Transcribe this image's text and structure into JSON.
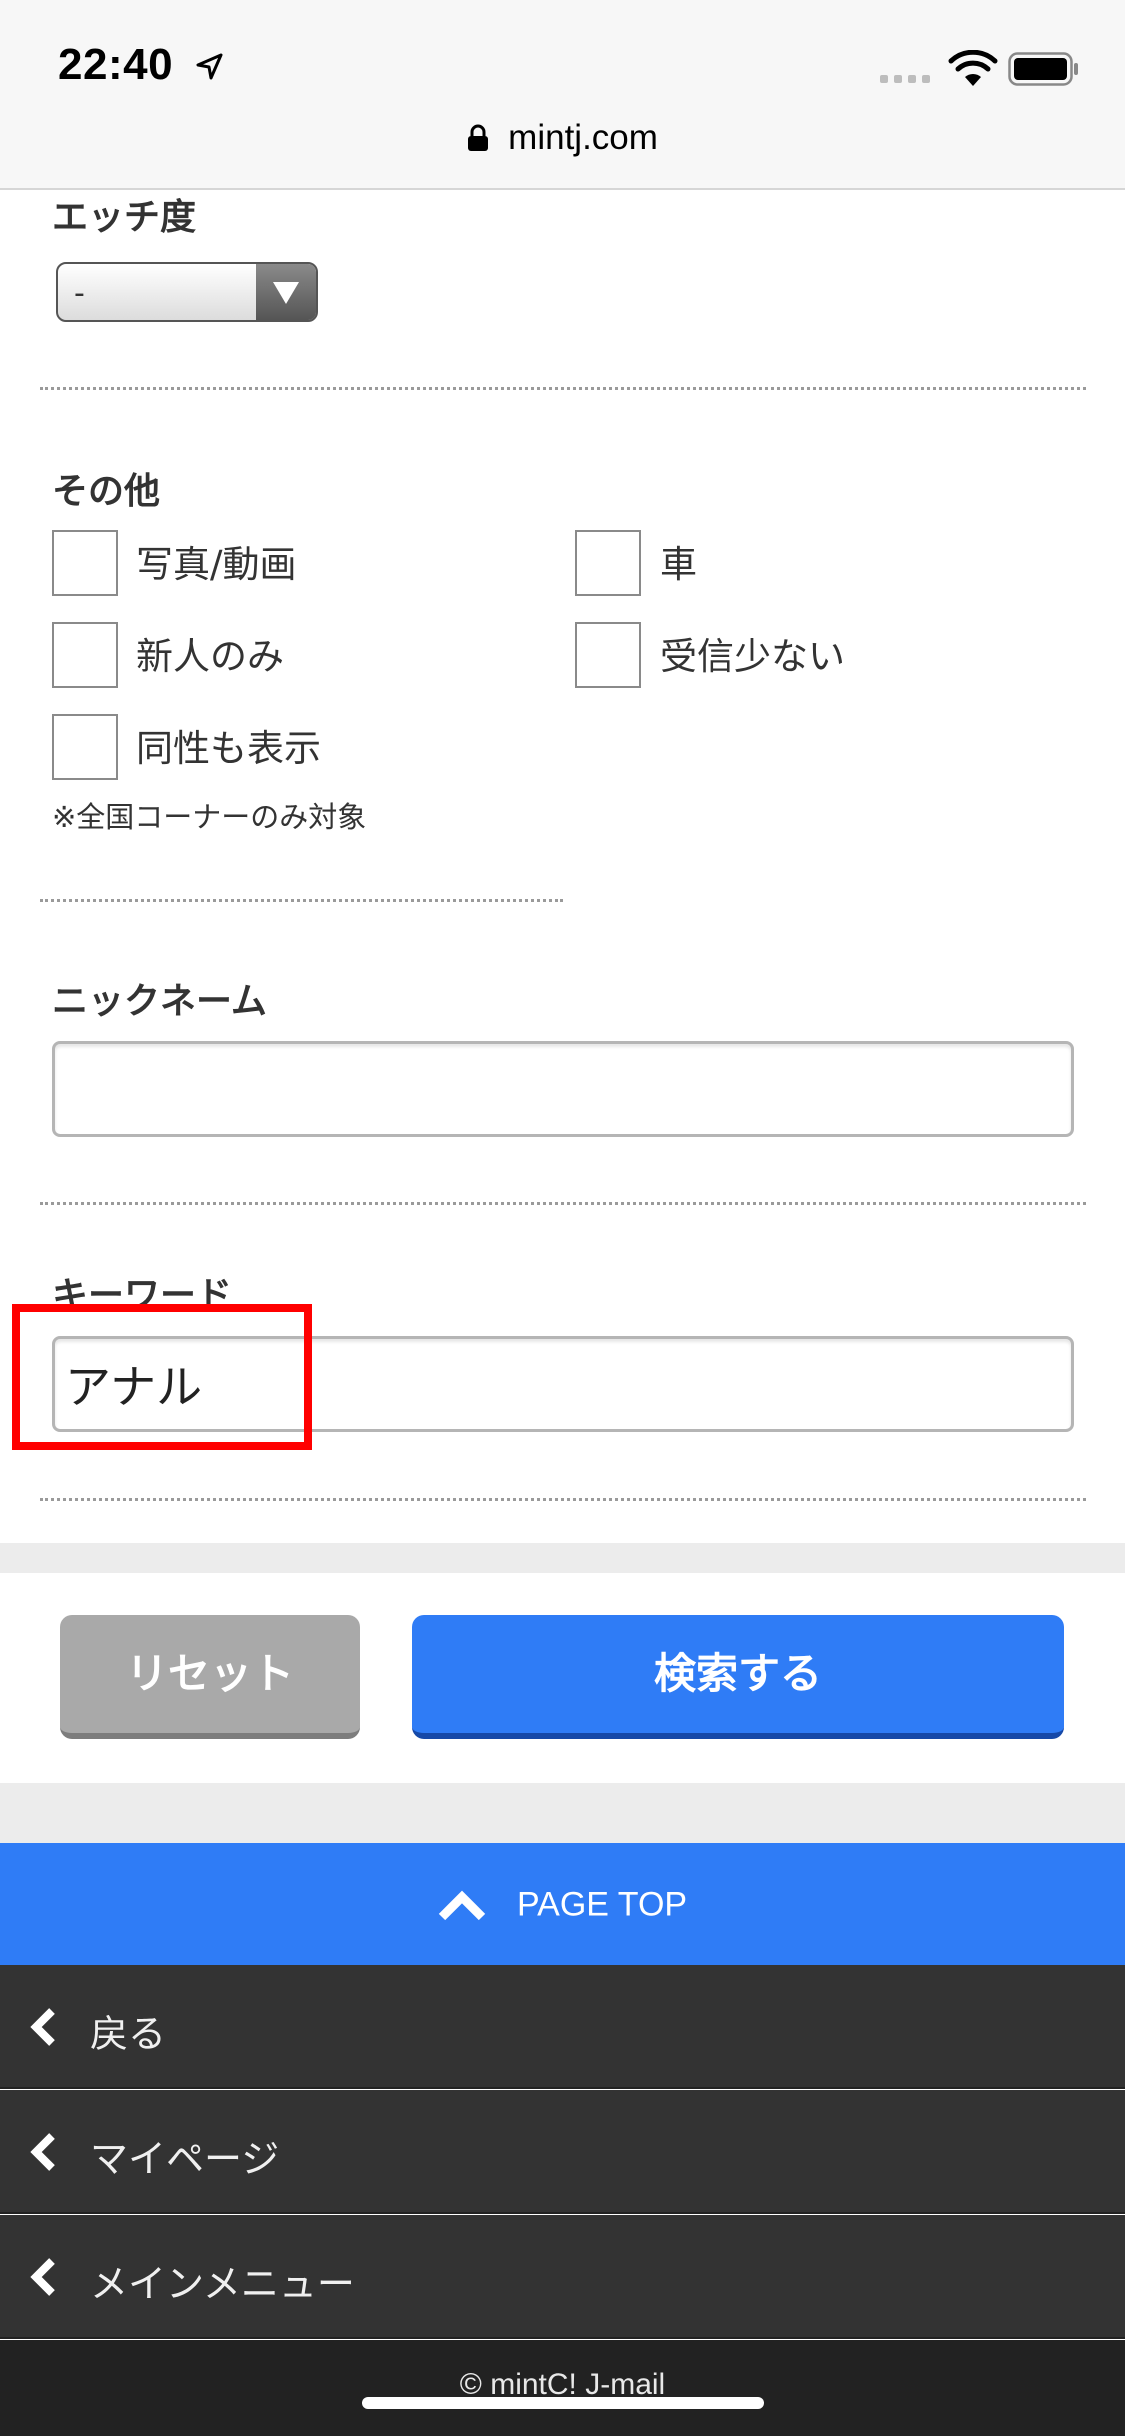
{
  "status_bar": {
    "time": "22:40",
    "url": "mintj.com"
  },
  "form": {
    "h_level": {
      "label": "エッチ度",
      "selected": "-"
    },
    "other": {
      "label": "その他",
      "options": [
        {
          "label": "写真/動画",
          "checked": false
        },
        {
          "label": "車",
          "checked": false
        },
        {
          "label": "新人のみ",
          "checked": false
        },
        {
          "label": "受信少ない",
          "checked": false
        },
        {
          "label": "同性も表示",
          "checked": false
        }
      ],
      "note": "※全国コーナーのみ対象"
    },
    "nickname": {
      "label": "ニックネーム",
      "value": ""
    },
    "keyword": {
      "label": "キーワード",
      "value": "アナル"
    }
  },
  "buttons": {
    "reset": "リセット",
    "search": "検索する"
  },
  "nav": {
    "page_top": "PAGE TOP",
    "items": [
      "戻る",
      "マイページ",
      "メインメニュー"
    ]
  },
  "footer": {
    "copyright": "© mintC! J-mail"
  },
  "colors": {
    "accent": "#2f7cf6",
    "nav_bg": "#333333",
    "highlight": "#ff0000"
  }
}
